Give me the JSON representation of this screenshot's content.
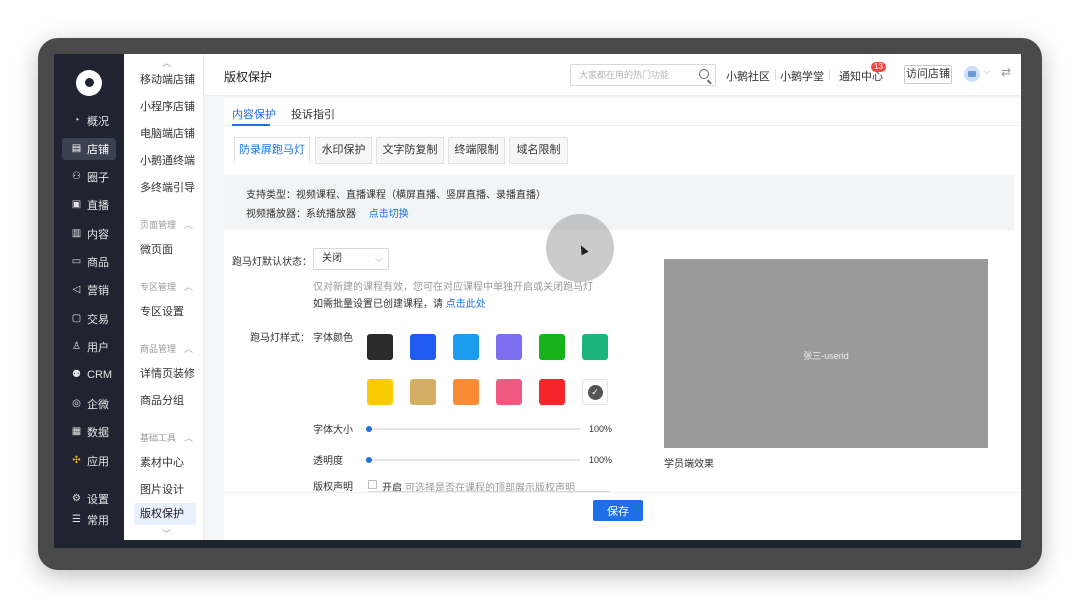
{
  "nav": {
    "items": [
      {
        "label": "概况",
        "icon": "dashboard-icon"
      },
      {
        "label": "店铺",
        "icon": "store-icon",
        "active": true
      },
      {
        "label": "圈子",
        "icon": "community-icon"
      },
      {
        "label": "直播",
        "icon": "live-icon"
      },
      {
        "label": "内容",
        "icon": "content-icon"
      },
      {
        "label": "商品",
        "icon": "goods-icon"
      },
      {
        "label": "营销",
        "icon": "megaphone-icon"
      },
      {
        "label": "交易",
        "icon": "trade-icon"
      },
      {
        "label": "用户",
        "icon": "user-icon"
      },
      {
        "label": "CRM",
        "icon": "crm-icon"
      },
      {
        "label": "企微",
        "icon": "wecom-icon"
      },
      {
        "label": "数据",
        "icon": "data-icon"
      },
      {
        "label": "应用",
        "icon": "apps-icon"
      }
    ],
    "bottom": [
      {
        "label": "设置",
        "icon": "gear-icon"
      },
      {
        "label": "常用",
        "icon": "menu-icon"
      }
    ]
  },
  "subnav": {
    "items_top": [
      "移动端店铺",
      "小程序店铺",
      "电脑端店铺",
      "小鹅通终端",
      "多终端引导"
    ],
    "group_page": "页面管理",
    "page_items": [
      "微页面"
    ],
    "group_zone": "专区管理",
    "zone_items": [
      "专区设置"
    ],
    "group_goods": "商品管理",
    "goods_items": [
      "详情页装修",
      "商品分组"
    ],
    "group_tools": "基础工具",
    "tool_items": [
      "素材中心",
      "图片设计",
      "版权保护"
    ]
  },
  "header": {
    "title": "版权保护",
    "search_placeholder": "大家都在用的热门功能",
    "links": [
      "小鹅社区",
      "小鹅学堂",
      "通知中心"
    ],
    "notify_count": "13",
    "visit_store": "访问店铺"
  },
  "tabs": [
    "内容保护",
    "投诉指引"
  ],
  "subtabs": [
    "防录屏跑马灯",
    "水印保护",
    "文字防复制",
    "终端限制",
    "域名限制"
  ],
  "info": {
    "support_types": "支持类型：视频课程、直播课程（横屏直播、竖屏直播、录播直播）",
    "player_prefix": "视频播放器：系统播放器",
    "player_link": "点击切换"
  },
  "form": {
    "default_state_label": "跑马灯默认状态：",
    "default_state_value": "关闭",
    "hint_line1": "仅对新建的课程有效，您可在对应课程中单独开启或关闭跑马灯",
    "hint_line2_prefix": "如需批量设置已创建课程，请",
    "hint_line2_link": "点击此处",
    "style_label": "跑马灯样式：",
    "font_color_label": "字体颜色",
    "colors_row1": [
      "#2b2b2b",
      "#1e5cf2",
      "#1a9cf0",
      "#7b6ff0",
      "#17b21a",
      "#1bb57b"
    ],
    "colors_row2": [
      "#f8cc00",
      "#d4ad64",
      "#fb8a34",
      "#f05a80",
      "#f4262a"
    ],
    "font_size_label": "字体大小",
    "font_size_value": "100%",
    "font_size_level": 0,
    "opacity_label": "透明度",
    "opacity_value": "100%",
    "opacity_level": 0,
    "copyright_label": "版权声明",
    "copyright_toggle": "开启",
    "copyright_hint": "可选择是否在课程的顶部展示版权声明"
  },
  "preview": {
    "watermark_text": "张三-userid",
    "caption": "学员端效果"
  },
  "footer": {
    "save_label": "保存"
  }
}
